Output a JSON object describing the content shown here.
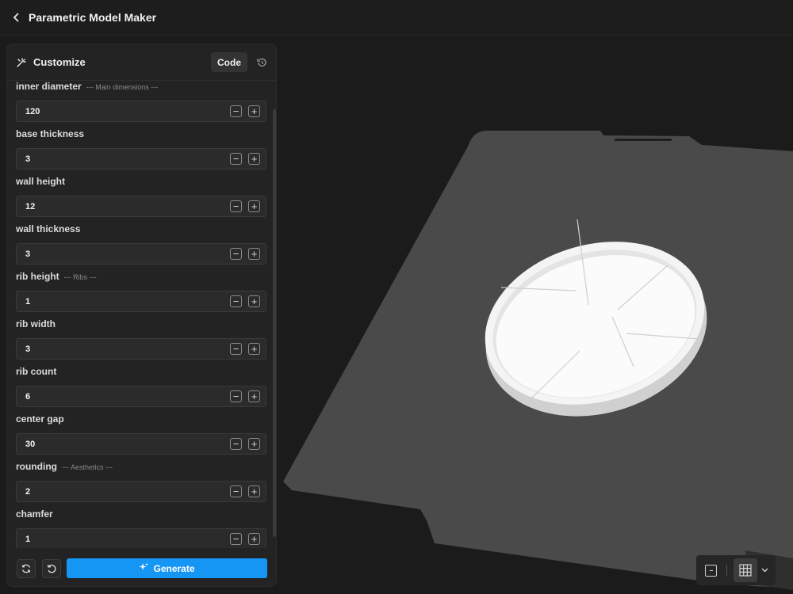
{
  "app": {
    "title": "Parametric Model Maker"
  },
  "panel": {
    "title": "Customize",
    "code_label": "Code"
  },
  "params": [
    {
      "label": "inner diameter",
      "section": "--- Main dimensions ---",
      "value": "120"
    },
    {
      "label": "base thickness",
      "section": "",
      "value": "3"
    },
    {
      "label": "wall height",
      "section": "",
      "value": "12"
    },
    {
      "label": "wall thickness",
      "section": "",
      "value": "3"
    },
    {
      "label": "rib height",
      "section": "--- Ribs ---",
      "value": "1"
    },
    {
      "label": "rib width",
      "section": "",
      "value": "3"
    },
    {
      "label": "rib count",
      "section": "",
      "value": "6"
    },
    {
      "label": "center gap",
      "section": "",
      "value": "30"
    },
    {
      "label": "rounding",
      "section": "--- Aesthetics ---",
      "value": "2"
    },
    {
      "label": "chamfer",
      "section": "",
      "value": "1"
    }
  ],
  "footer": {
    "generate_label": "Generate"
  },
  "icons": {
    "back": "chevron-left-icon",
    "customize": "wand-icon",
    "history": "history-icon",
    "refresh": "refresh-icon",
    "reset": "undo-icon",
    "spark": "sparkle-icon",
    "grid": "grid-icon"
  },
  "colors": {
    "accent": "#1596f5",
    "bed": "#4a4a4a",
    "model": "#f2f2f2"
  }
}
